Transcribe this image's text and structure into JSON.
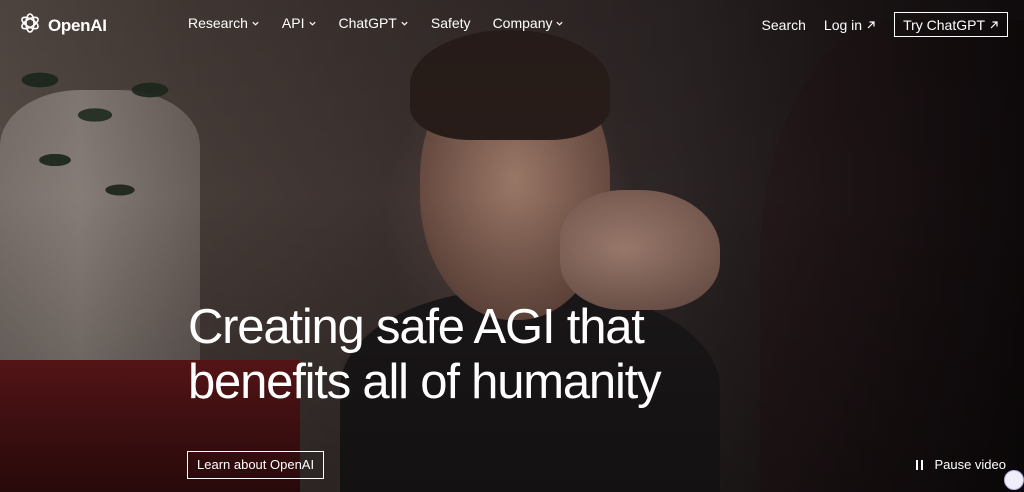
{
  "brand": {
    "name": "OpenAI",
    "icon": "openai-logo-icon"
  },
  "nav": {
    "items": [
      {
        "label": "Research",
        "has_dropdown": true
      },
      {
        "label": "API",
        "has_dropdown": true
      },
      {
        "label": "ChatGPT",
        "has_dropdown": true
      },
      {
        "label": "Safety",
        "has_dropdown": false
      },
      {
        "label": "Company",
        "has_dropdown": true
      }
    ],
    "search_label": "Search",
    "login_label": "Log in",
    "try_label": "Try ChatGPT"
  },
  "hero": {
    "headline_line1": "Creating safe AGI that",
    "headline_line2": "benefits all of humanity",
    "cta_label": "Learn about OpenAI",
    "pause_label": "Pause video"
  },
  "colors": {
    "text": "#ffffff",
    "accent_bubble": "#b9aef0"
  }
}
